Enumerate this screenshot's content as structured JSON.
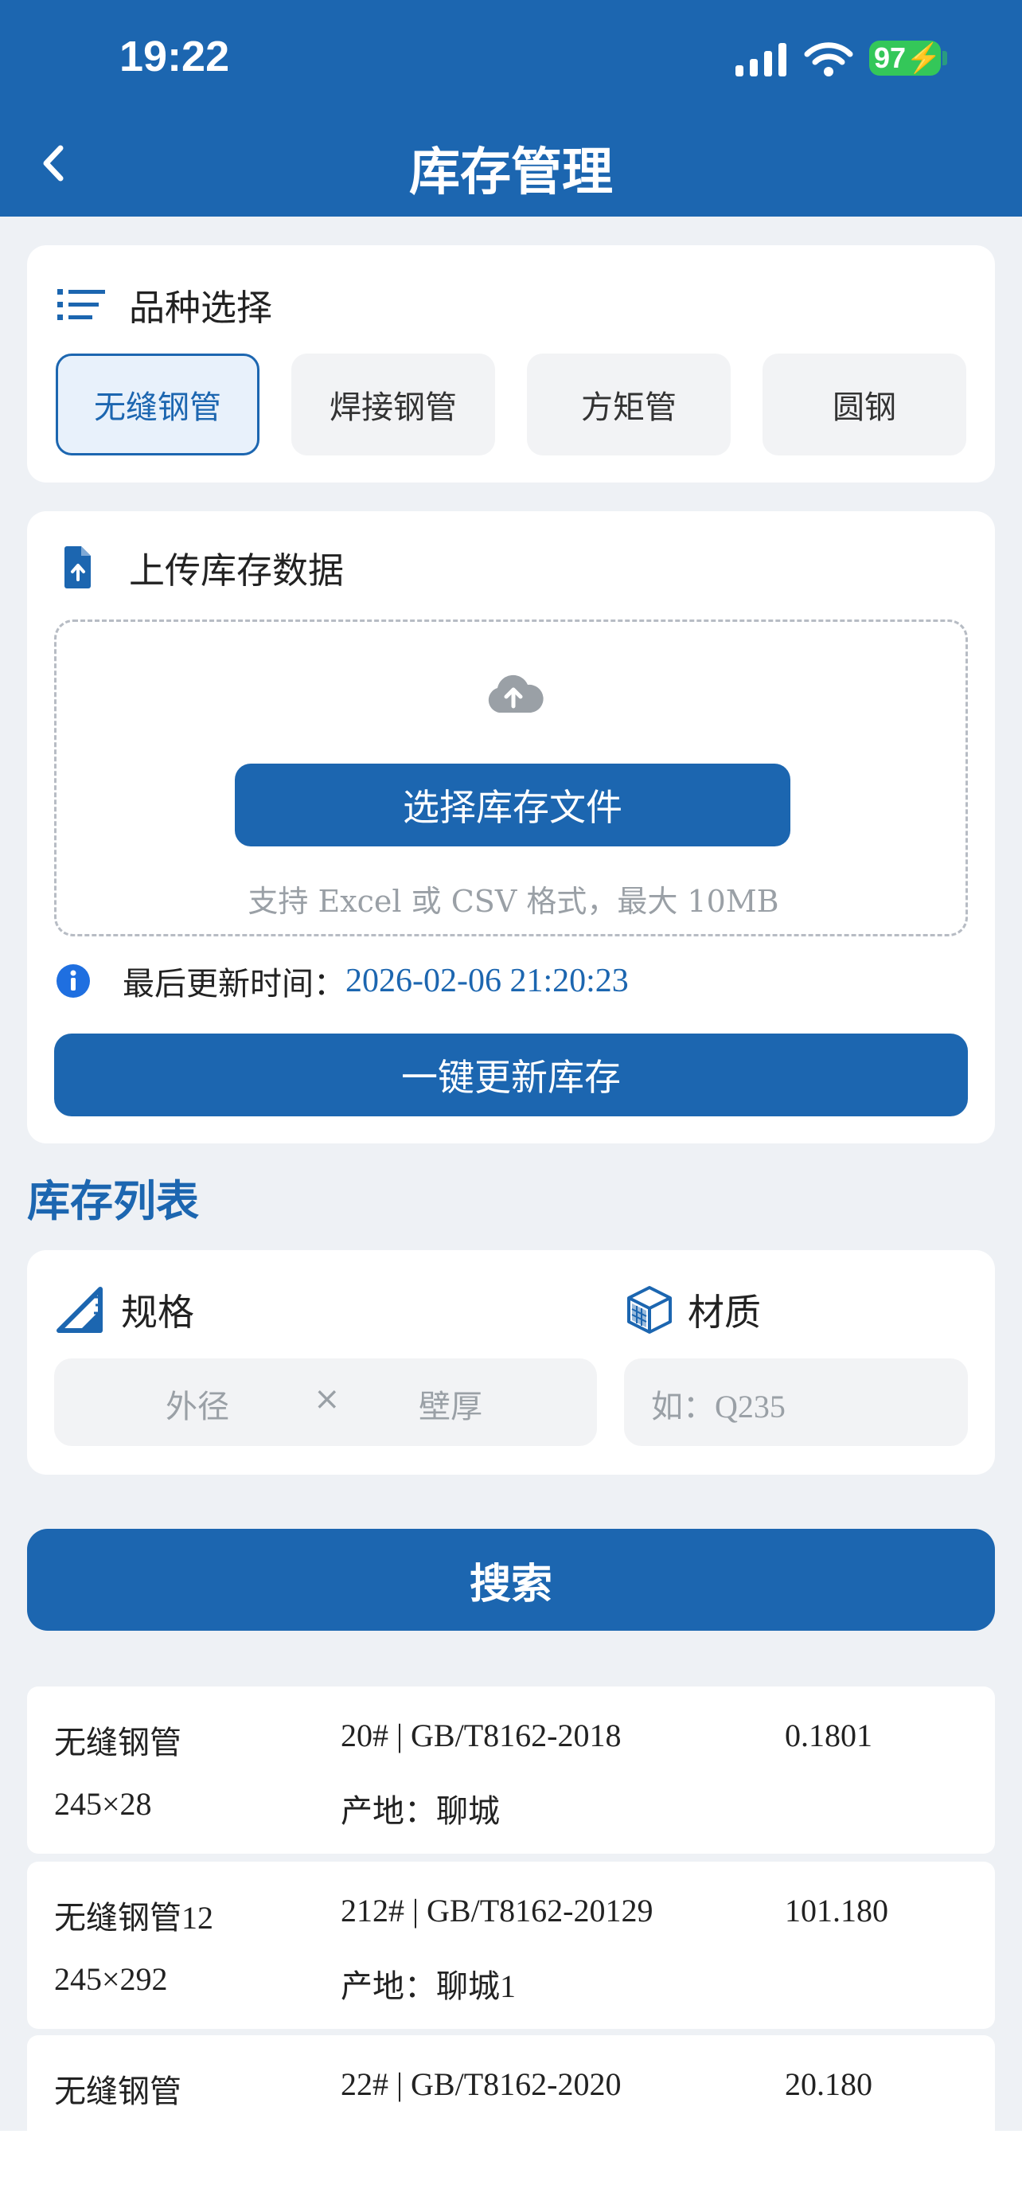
{
  "status_bar": {
    "time": "19:22",
    "battery": "97"
  },
  "nav": {
    "title": "库存管理"
  },
  "variety": {
    "title": "品种选择",
    "options": [
      "无缝钢管",
      "焊接钢管",
      "方矩管",
      "圆钢"
    ],
    "selected": "无缝钢管"
  },
  "upload": {
    "title": "上传库存数据",
    "button_label": "选择库存文件",
    "hint": "支持 Excel 或 CSV 格式，最大 10MB",
    "last_update_label": "最后更新时间：",
    "last_update_value": "2026-02-06 21:20:23",
    "update_button_label": "一键更新库存"
  },
  "inventory": {
    "section_title": "库存列表",
    "spec_label": "规格",
    "material_label": "材质",
    "od_placeholder": "外径",
    "times": "×",
    "wall_placeholder": "壁厚",
    "material_placeholder": "如：Q235",
    "search_label": "搜索"
  },
  "rows": [
    {
      "name": "无缝钢管",
      "size": "245×28",
      "grade_std": "20# | GB/T8162-2018",
      "origin": "产地：聊城",
      "value": "0.1801"
    },
    {
      "name": "无缝钢管12",
      "size": "245×292",
      "grade_std": "212# | GB/T8162-20129",
      "origin": "产地：聊城1",
      "value": "101.180"
    },
    {
      "name": "无缝钢管",
      "size": "",
      "grade_std": "22# | GB/T8162-2020",
      "origin": "",
      "value": "20.180"
    }
  ],
  "colors": {
    "primary": "#1c66b0",
    "background": "#eef1f5",
    "chip_bg": "#f2f3f5",
    "battery": "#34c759"
  }
}
